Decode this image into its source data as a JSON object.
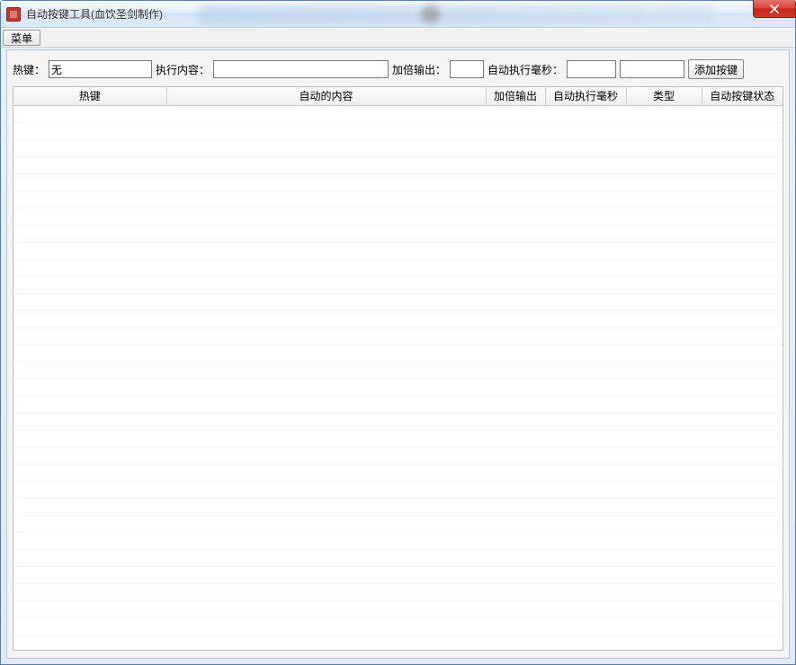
{
  "window": {
    "title": "自动按键工具(血饮圣剑制作)"
  },
  "menubar": {
    "menu_label": "菜单"
  },
  "form": {
    "hotkey_label": "热键：",
    "hotkey_value": "无",
    "content_label": "执行内容：",
    "content_value": "",
    "double_label": "加倍输出：",
    "double_value": "",
    "ms_label": "自动执行毫秒：",
    "ms_value": "",
    "type_value": "",
    "add_button_label": "添加按键"
  },
  "table": {
    "columns": [
      "热键",
      "自动的内容",
      "加倍输出",
      "自动执行毫秒",
      "类型",
      "自动按键状态"
    ],
    "rows": []
  }
}
